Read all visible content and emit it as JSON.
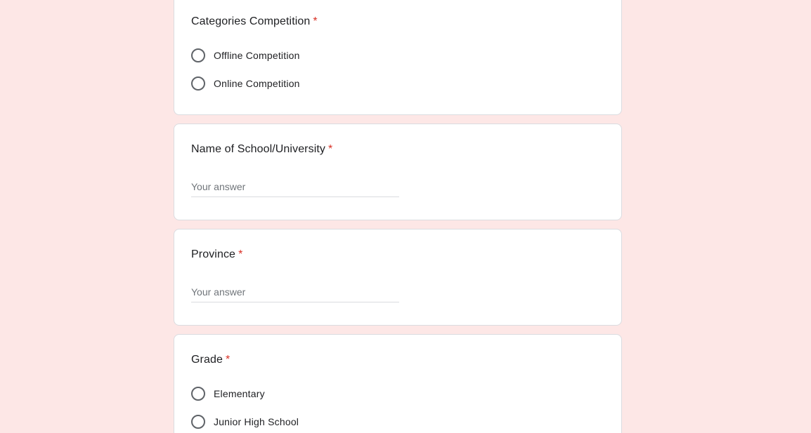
{
  "questions": [
    {
      "title": "Categories Competition",
      "required_mark": "*",
      "options": [
        "Offline Competition",
        "Online Competition"
      ]
    },
    {
      "title": "Name of School/University",
      "required_mark": "*",
      "placeholder": "Your answer"
    },
    {
      "title": "Province",
      "required_mark": "*",
      "placeholder": "Your answer"
    },
    {
      "title": "Grade",
      "required_mark": "*",
      "options": [
        "Elementary",
        "Junior High School"
      ]
    }
  ],
  "colors": {
    "page_background": "#fde7e6",
    "card_background": "#ffffff",
    "required_asterisk": "#d93025",
    "radio_border": "#5f6368"
  }
}
